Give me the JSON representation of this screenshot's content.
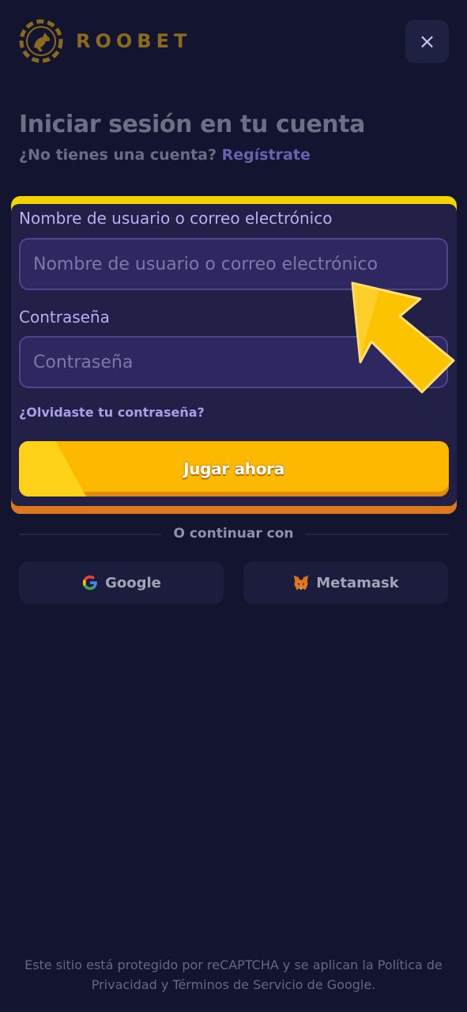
{
  "header": {
    "brand": "ROOBET",
    "close_label": "×",
    "logo_icon": "kangaroo-roulette-logo",
    "close_icon": "close-icon"
  },
  "intro": {
    "title": "Iniciar sesión en tu cuenta",
    "prompt": "¿No tienes una cuenta?",
    "register_link": "Regístrate"
  },
  "form": {
    "username_label": "Nombre de usuario o correo electrónico",
    "username_placeholder": "Nombre de usuario o correo electrónico",
    "username_value": "",
    "password_label": "Contraseña",
    "password_placeholder": "Contraseña",
    "password_value": "",
    "forgot_link": "¿Olvidaste tu contraseña?",
    "submit_label": "Jugar ahora",
    "highlight_color": "#f1d400"
  },
  "social": {
    "divider_text": "O continuar con",
    "buttons": [
      {
        "label": "Google",
        "icon": "google-icon"
      },
      {
        "label": "Metamask",
        "icon": "metamask-fox-icon"
      }
    ]
  },
  "footer": {
    "text": "Este sitio está protegido por reCAPTCHA y se aplican la Política de Privacidad y Términos de Servicio de Google."
  },
  "colors": {
    "background": "#13142f",
    "brand_gold": "#8a6a1c",
    "accent_purple": "#6b5fb0",
    "button_yellow": "#fcb900",
    "pointer_arrow": "#fcc300"
  }
}
